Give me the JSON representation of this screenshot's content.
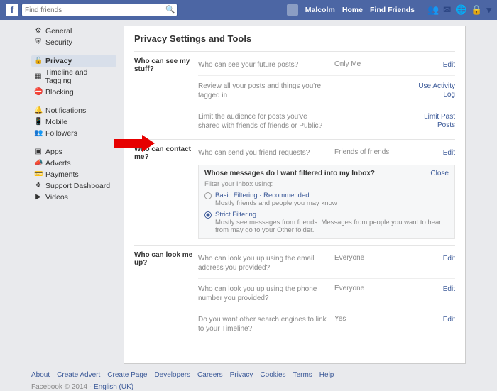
{
  "topbar": {
    "search_placeholder": "Find friends",
    "user": "Malcolm",
    "home": "Home",
    "find_friends": "Find Friends"
  },
  "leftnav": {
    "g1": [
      {
        "icon": "⚙",
        "label": "General",
        "name": "general"
      },
      {
        "icon": "⛨",
        "label": "Security",
        "name": "security"
      }
    ],
    "g2": [
      {
        "icon": "🔒",
        "label": "Privacy",
        "name": "privacy",
        "active": true
      },
      {
        "icon": "▦",
        "label": "Timeline and Tagging",
        "name": "timeline"
      },
      {
        "icon": "⛔",
        "label": "Blocking",
        "name": "blocking"
      }
    ],
    "g3": [
      {
        "icon": "🔔",
        "label": "Notifications",
        "name": "notifications"
      },
      {
        "icon": "📱",
        "label": "Mobile",
        "name": "mobile"
      },
      {
        "icon": "👥",
        "label": "Followers",
        "name": "followers"
      }
    ],
    "g4": [
      {
        "icon": "▣",
        "label": "Apps",
        "name": "apps"
      },
      {
        "icon": "📣",
        "label": "Adverts",
        "name": "adverts"
      },
      {
        "icon": "💳",
        "label": "Payments",
        "name": "payments"
      },
      {
        "icon": "❖",
        "label": "Support Dashboard",
        "name": "support"
      },
      {
        "icon": "▶",
        "label": "Videos",
        "name": "videos"
      }
    ]
  },
  "page": {
    "title": "Privacy Settings and Tools"
  },
  "sections": {
    "stuff": {
      "label": "Who can see my stuff?",
      "rows": [
        {
          "desc": "Who can see your future posts?",
          "val": "Only Me",
          "act": "Edit"
        },
        {
          "desc": "Review all your posts and things you're tagged in",
          "val": "",
          "act": "Use Activity Log"
        },
        {
          "desc": "Limit the audience for posts you've shared with friends of friends or Public?",
          "val": "",
          "act": "Limit Past Posts"
        }
      ]
    },
    "contact": {
      "label": "Who can contact me?",
      "row": {
        "desc": "Who can send you friend requests?",
        "val": "Friends of friends",
        "act": "Edit"
      },
      "expanded": {
        "header": "Whose messages do I want filtered into my Inbox?",
        "close": "Close",
        "sub": "Filter your Inbox using:",
        "opts": [
          {
            "label": "Basic Filtering · Recommended",
            "sub": "Mostly friends and people you may know",
            "selected": false
          },
          {
            "label": "Strict Filtering",
            "sub": "Mostly see messages from friends. Messages from people you want to hear from may go to your Other folder.",
            "selected": true
          }
        ]
      }
    },
    "lookup": {
      "label": "Who can look me up?",
      "rows": [
        {
          "desc": "Who can look you up using the email address you provided?",
          "val": "Everyone",
          "act": "Edit"
        },
        {
          "desc": "Who can look you up using the phone number you provided?",
          "val": "Everyone",
          "act": "Edit"
        },
        {
          "desc": "Do you want other search engines to link to your Timeline?",
          "val": "Yes",
          "act": "Edit"
        }
      ]
    }
  },
  "footer": {
    "links": [
      "About",
      "Create Advert",
      "Create Page",
      "Developers",
      "Careers",
      "Privacy",
      "Cookies",
      "Terms",
      "Help"
    ],
    "copyright": "Facebook © 2014 ·",
    "lang": "English (UK)"
  }
}
